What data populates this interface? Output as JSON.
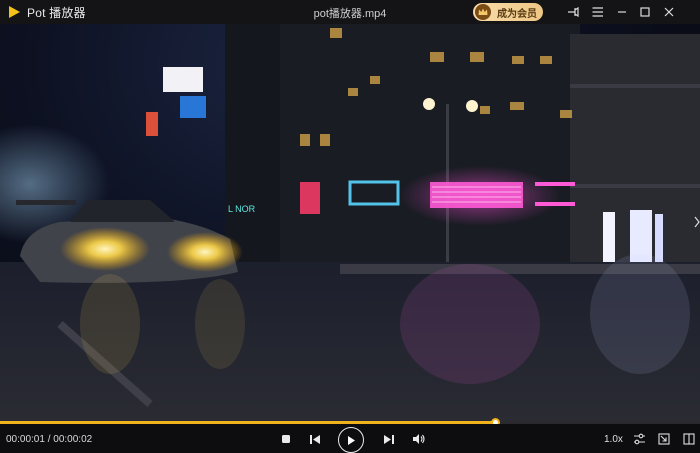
{
  "app": {
    "name": "Pot 播放器",
    "file_title": "pot播放器.mp4"
  },
  "header": {
    "vip_label": "成为会员"
  },
  "playback": {
    "time_text": "00:00:01 / 00:00:02",
    "progress": 0.707,
    "speed_label": "1.0x"
  },
  "video": {
    "signs": [
      "L NOR"
    ]
  },
  "colors": {
    "accent": "#f2b21b",
    "vip_bg": "#eec783",
    "neon_pink": "#ff4fd8",
    "neon_blue": "#5ad6ff"
  },
  "icons": {
    "logo": "pot-player-logo-icon",
    "vip": "crown-icon",
    "titlebar": [
      "pin-icon",
      "menu-icon",
      "minimize-icon",
      "maximize-icon",
      "close-icon"
    ],
    "controls": [
      "stop-icon",
      "previous-icon",
      "play-icon",
      "next-icon",
      "volume-icon"
    ],
    "right_controls": [
      "settings-sliders-icon",
      "shrink-icon",
      "fullscreen-icon"
    ]
  }
}
